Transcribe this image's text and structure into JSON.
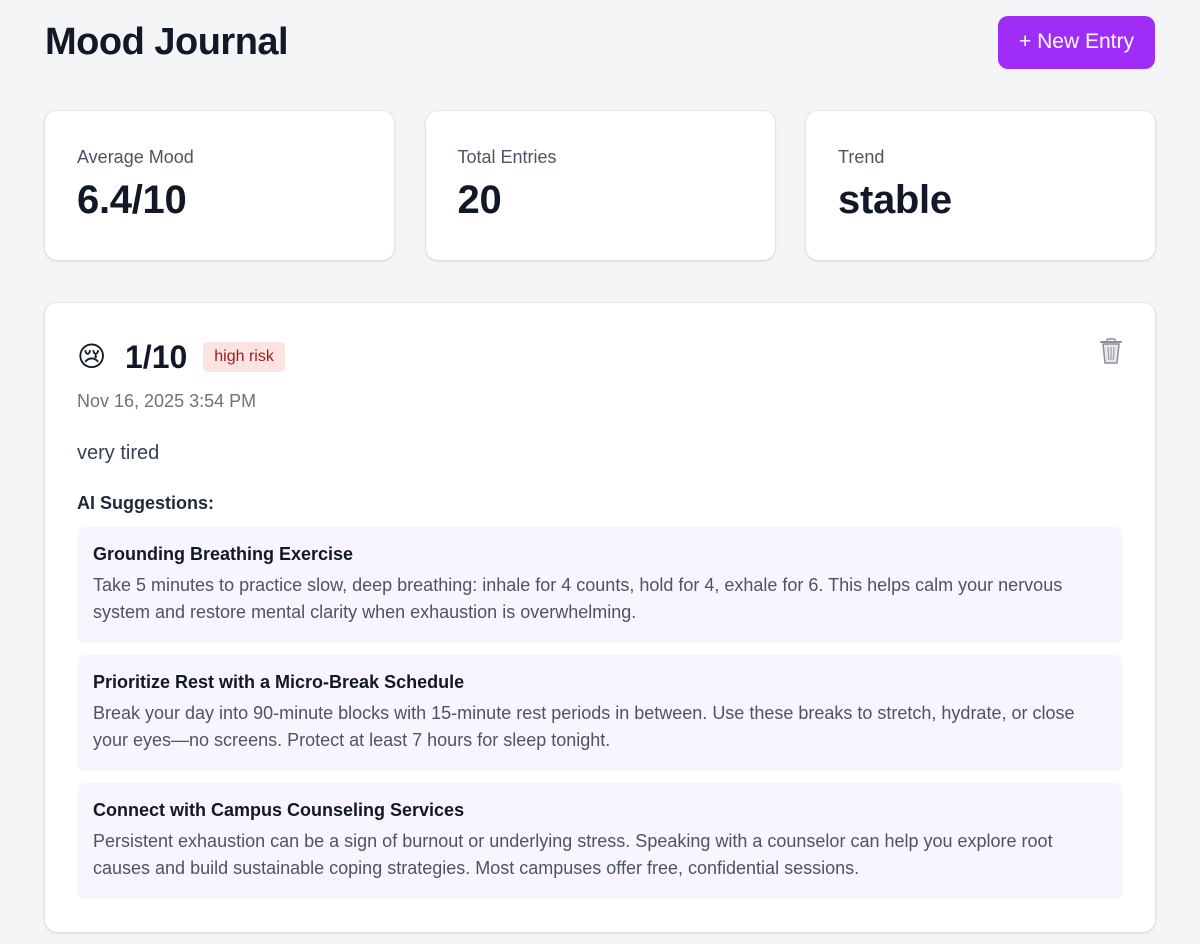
{
  "header": {
    "title": "Mood Journal",
    "new_entry_label": "+ New Entry"
  },
  "stats": [
    {
      "label": "Average Mood",
      "value": "6.4/10"
    },
    {
      "label": "Total Entries",
      "value": "20"
    },
    {
      "label": "Trend",
      "value": "stable"
    }
  ],
  "entry": {
    "emoji": "😢",
    "score": "1/10",
    "risk": "high risk",
    "date": "Nov 16, 2025 3:54 PM",
    "note": "very tired",
    "delete_icon": "trash-icon",
    "suggestions_heading": "AI Suggestions:",
    "suggestions": [
      {
        "title": "Grounding Breathing Exercise",
        "body": "Take 5 minutes to practice slow, deep breathing: inhale for 4 counts, hold for 4, exhale for 6. This helps calm your nervous system and restore mental clarity when exhaustion is overwhelming."
      },
      {
        "title": "Prioritize Rest with a Micro-Break Schedule",
        "body": "Break your day into 90-minute blocks with 15-minute rest periods in between. Use these breaks to stretch, hydrate, or close your eyes—no screens. Protect at least 7 hours for sleep tonight."
      },
      {
        "title": "Connect with Campus Counseling Services",
        "body": "Persistent exhaustion can be a sign of burnout or underlying stress. Speaking with a counselor can help you explore root causes and build sustainable coping strategies. Most campuses offer free, confidential sessions."
      }
    ]
  },
  "colors": {
    "accent": "#a02cf8",
    "background": "#f4f5f7",
    "risk_bg": "#fde2e2",
    "risk_text": "#9b1c1c",
    "suggestion_bg": "#f8f5ff"
  }
}
